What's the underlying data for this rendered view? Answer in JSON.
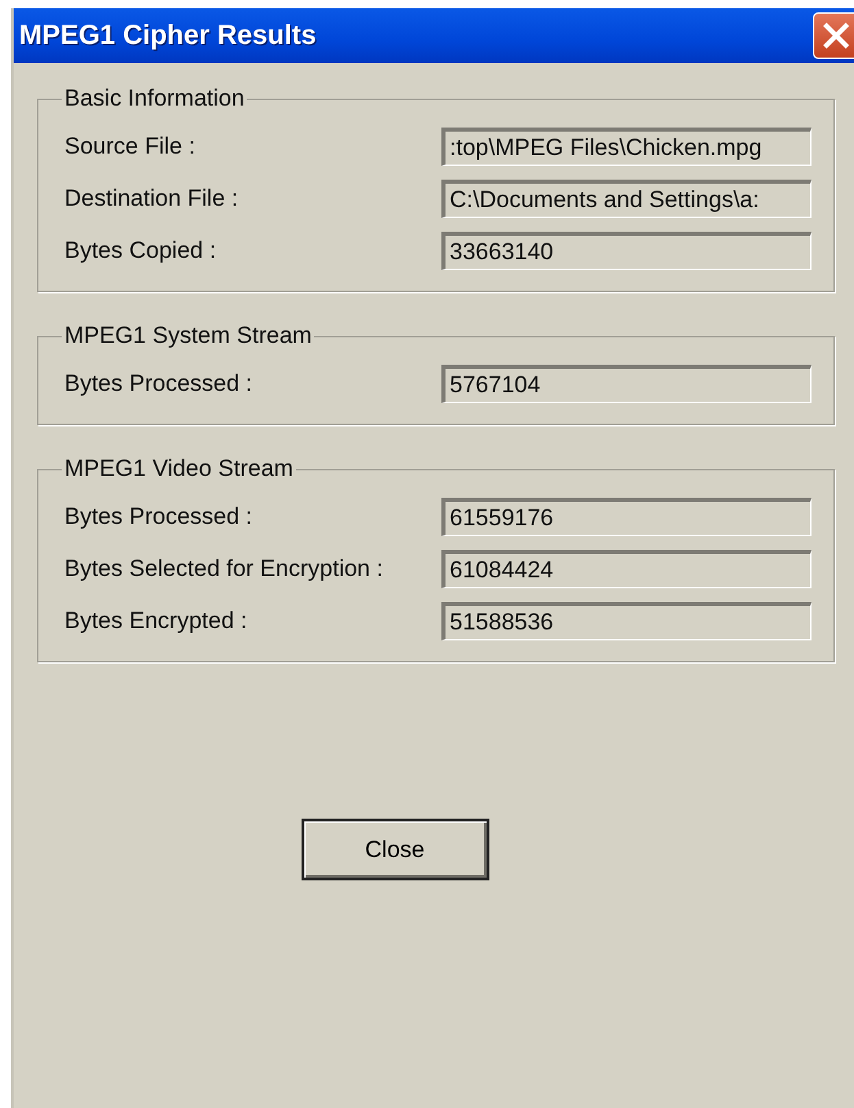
{
  "window": {
    "title": "MPEG1 Cipher Results"
  },
  "groups": [
    {
      "title": "Basic Information",
      "fields": [
        {
          "label": "Source File :",
          "value": ":top\\MPEG Files\\Chicken.mpg"
        },
        {
          "label": "Destination File :",
          "value": "C:\\Documents and Settings\\a:"
        },
        {
          "label": "Bytes Copied :",
          "value": "33663140"
        }
      ]
    },
    {
      "title": "MPEG1 System Stream",
      "fields": [
        {
          "label": "Bytes Processed :",
          "value": "5767104"
        }
      ]
    },
    {
      "title": "MPEG1 Video Stream",
      "fields": [
        {
          "label": "Bytes Processed :",
          "value": "61559176"
        },
        {
          "label": "Bytes Selected for Encryption :",
          "value": "61084424"
        },
        {
          "label": "Bytes Encrypted :",
          "value": "51588536"
        }
      ]
    }
  ],
  "buttons": [
    "Close"
  ]
}
